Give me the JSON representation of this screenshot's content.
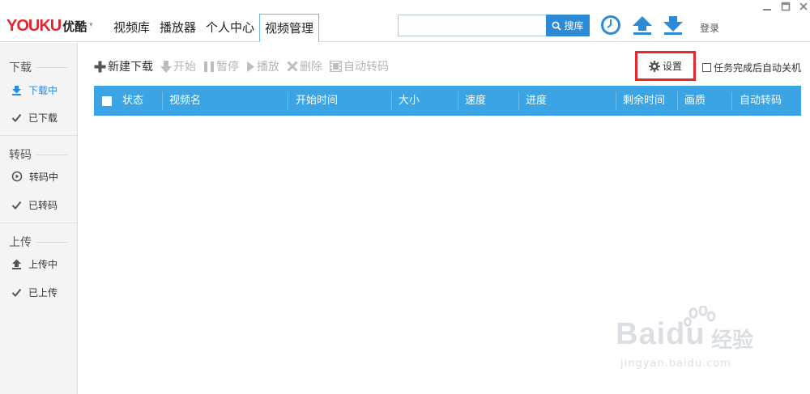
{
  "app": {
    "logo_text": "YOUKU",
    "logo_cn": "优酷",
    "logo_caret": "▾"
  },
  "nav": {
    "tabs": [
      {
        "label": "视频库"
      },
      {
        "label": "播放器"
      },
      {
        "label": "个人中心"
      },
      {
        "label": "视频管理",
        "active": true
      }
    ]
  },
  "search": {
    "value": "",
    "placeholder": "",
    "button_label": "搜库"
  },
  "header": {
    "login_label": "登录"
  },
  "sidebar": {
    "groups": [
      {
        "title": "下载",
        "items": [
          {
            "label": "下载中",
            "icon": "download-arrow-icon",
            "active": true
          },
          {
            "label": "已下载",
            "icon": "check-icon"
          }
        ]
      },
      {
        "title": "转码",
        "items": [
          {
            "label": "转码中",
            "icon": "transcode-icon"
          },
          {
            "label": "已转码",
            "icon": "check-icon"
          }
        ]
      },
      {
        "title": "上传",
        "items": [
          {
            "label": "上传中",
            "icon": "upload-arrow-icon"
          },
          {
            "label": "已上传",
            "icon": "check-icon"
          }
        ]
      }
    ]
  },
  "toolbar": {
    "new_download": "新建下载",
    "start": "开始",
    "pause": "暂停",
    "play": "播放",
    "delete": "删除",
    "auto_transcode": "自动转码",
    "settings": "设置",
    "auto_shutdown": "任务完成后自动关机"
  },
  "table": {
    "columns": [
      "状态",
      "视频名",
      "开始时间",
      "大小",
      "速度",
      "进度",
      "剩余时间",
      "画质",
      "自动转码"
    ],
    "rows": []
  },
  "watermark": {
    "brand": "Bai",
    "brand2": "du",
    "cn": "经验",
    "url": "jingyan.baidu.com"
  },
  "colors": {
    "accent": "#2d8ad6",
    "table_header": "#3aa4e4",
    "highlight_box": "#e8262b",
    "logo_red": "#e6262f"
  }
}
